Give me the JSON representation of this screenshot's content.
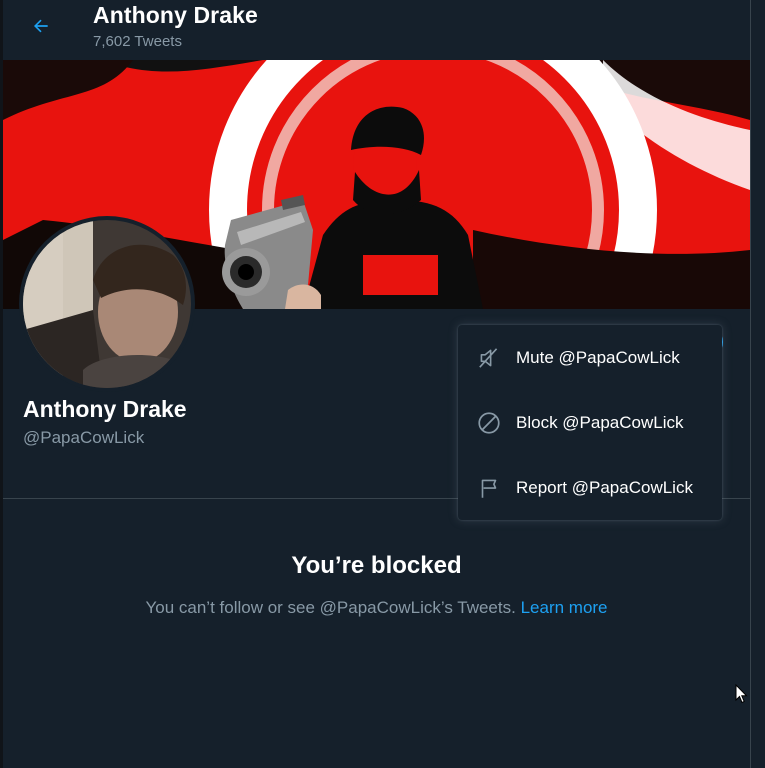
{
  "header": {
    "name": "Anthony Drake",
    "tweet_count": "7,602 Tweets"
  },
  "profile": {
    "name": "Anthony Drake",
    "handle": "@PapaCowLick"
  },
  "menu": {
    "items": [
      {
        "label": "Mute @PapaCowLick",
        "icon": "mute-icon"
      },
      {
        "label": "Block @PapaCowLick",
        "icon": "block-icon"
      },
      {
        "label": "Report @PapaCowLick",
        "icon": "flag-icon"
      }
    ]
  },
  "blocked": {
    "title": "You’re blocked",
    "message": "You can’t follow or see @PapaCowLick’s Tweets.",
    "link": "Learn more"
  },
  "colors": {
    "background": "#15202b",
    "accent": "#1da1f2",
    "secondary_text": "#8899a6",
    "banner_red": "#e8130e"
  }
}
